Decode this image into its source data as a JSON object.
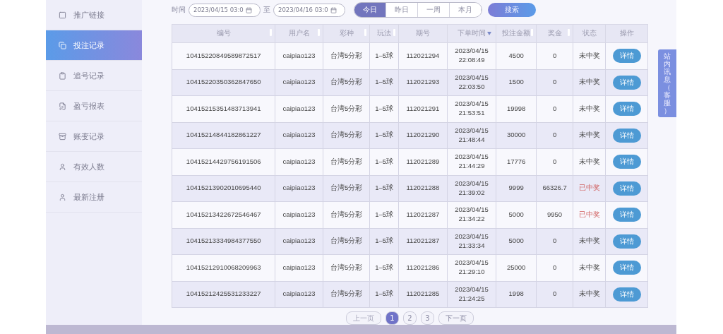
{
  "sidebar": {
    "items": [
      {
        "label": "推广链接",
        "selected": false
      },
      {
        "label": "投注记录",
        "selected": true
      },
      {
        "label": "追号记录",
        "selected": false
      },
      {
        "label": "盈亏报表",
        "selected": false
      },
      {
        "label": "账变记录",
        "selected": false
      },
      {
        "label": "有效人数",
        "selected": false
      },
      {
        "label": "最新注册",
        "selected": false
      }
    ]
  },
  "filters": {
    "time_label": "时间",
    "start": "2023/04/15 03:0",
    "separator": "至",
    "end": "2023/04/16 03:0",
    "ranges": [
      {
        "label": "今日",
        "selected": true
      },
      {
        "label": "昨日",
        "selected": false
      },
      {
        "label": "一周",
        "selected": false
      },
      {
        "label": "本月",
        "selected": false
      }
    ],
    "search_button": "搜索"
  },
  "table": {
    "columns": [
      {
        "label": "编号",
        "sortable": true,
        "sorted": false
      },
      {
        "label": "用户名",
        "sortable": true,
        "sorted": false
      },
      {
        "label": "彩种",
        "sortable": true,
        "sorted": false
      },
      {
        "label": "玩法",
        "sortable": true,
        "sorted": false
      },
      {
        "label": "期号",
        "sortable": false,
        "sorted": false
      },
      {
        "label": "下单时间",
        "sortable": true,
        "sorted": true
      },
      {
        "label": "投注金额",
        "sortable": true,
        "sorted": false
      },
      {
        "label": "奖金",
        "sortable": true,
        "sorted": false
      },
      {
        "label": "状态",
        "sortable": false,
        "sorted": false
      },
      {
        "label": "操作",
        "sortable": false,
        "sorted": false
      }
    ],
    "rows": [
      {
        "id": "10415220849589872517",
        "user": "caipiao123",
        "lottery": "台湾5分彩",
        "play": "1–5球",
        "issue": "112021294",
        "date": "2023/04/15",
        "time": "22:08:49",
        "amount": "4500",
        "prize": "0",
        "status": "未中奖",
        "won": false,
        "action": "详情"
      },
      {
        "id": "10415220350362847650",
        "user": "caipiao123",
        "lottery": "台湾5分彩",
        "play": "1–5球",
        "issue": "112021293",
        "date": "2023/04/15",
        "time": "22:03:50",
        "amount": "1500",
        "prize": "0",
        "status": "未中奖",
        "won": false,
        "action": "详情"
      },
      {
        "id": "10415215351483713941",
        "user": "caipiao123",
        "lottery": "台湾5分彩",
        "play": "1–5球",
        "issue": "112021291",
        "date": "2023/04/15",
        "time": "21:53:51",
        "amount": "19998",
        "prize": "0",
        "status": "未中奖",
        "won": false,
        "action": "详情"
      },
      {
        "id": "10415214844182861227",
        "user": "caipiao123",
        "lottery": "台湾5分彩",
        "play": "1–5球",
        "issue": "112021290",
        "date": "2023/04/15",
        "time": "21:48:44",
        "amount": "30000",
        "prize": "0",
        "status": "未中奖",
        "won": false,
        "action": "详情"
      },
      {
        "id": "10415214429756191506",
        "user": "caipiao123",
        "lottery": "台湾5分彩",
        "play": "1–5球",
        "issue": "112021289",
        "date": "2023/04/15",
        "time": "21:44:29",
        "amount": "17776",
        "prize": "0",
        "status": "未中奖",
        "won": false,
        "action": "详情"
      },
      {
        "id": "10415213902010695440",
        "user": "caipiao123",
        "lottery": "台湾5分彩",
        "play": "1–5球",
        "issue": "112021288",
        "date": "2023/04/15",
        "time": "21:39:02",
        "amount": "9999",
        "prize": "66326.7",
        "status": "已中奖",
        "won": true,
        "action": "详情"
      },
      {
        "id": "10415213422672546467",
        "user": "caipiao123",
        "lottery": "台湾5分彩",
        "play": "1–5球",
        "issue": "112021287",
        "date": "2023/04/15",
        "time": "21:34:22",
        "amount": "5000",
        "prize": "9950",
        "status": "已中奖",
        "won": true,
        "action": "详情"
      },
      {
        "id": "10415213334984377550",
        "user": "caipiao123",
        "lottery": "台湾5分彩",
        "play": "1–5球",
        "issue": "112021287",
        "date": "2023/04/15",
        "time": "21:33:34",
        "amount": "5000",
        "prize": "0",
        "status": "未中奖",
        "won": false,
        "action": "详情"
      },
      {
        "id": "10415212910068209963",
        "user": "caipiao123",
        "lottery": "台湾5分彩",
        "play": "1–5球",
        "issue": "112021286",
        "date": "2023/04/15",
        "time": "21:29:10",
        "amount": "25000",
        "prize": "0",
        "status": "未中奖",
        "won": false,
        "action": "详情"
      },
      {
        "id": "10415212425531233227",
        "user": "caipiao123",
        "lottery": "台湾5分彩",
        "play": "1–5球",
        "issue": "112021285",
        "date": "2023/04/15",
        "time": "21:24:25",
        "amount": "1998",
        "prize": "0",
        "status": "未中奖",
        "won": false,
        "action": "详情"
      }
    ]
  },
  "pagination": {
    "prev": {
      "label": "上一页",
      "disabled": true
    },
    "pages": [
      {
        "label": "1",
        "selected": true
      },
      {
        "label": "2",
        "selected": false
      },
      {
        "label": "3",
        "selected": false
      }
    ],
    "next": {
      "label": "下一页",
      "disabled": false
    }
  },
  "side_tab": "站内讯息（客服）"
}
